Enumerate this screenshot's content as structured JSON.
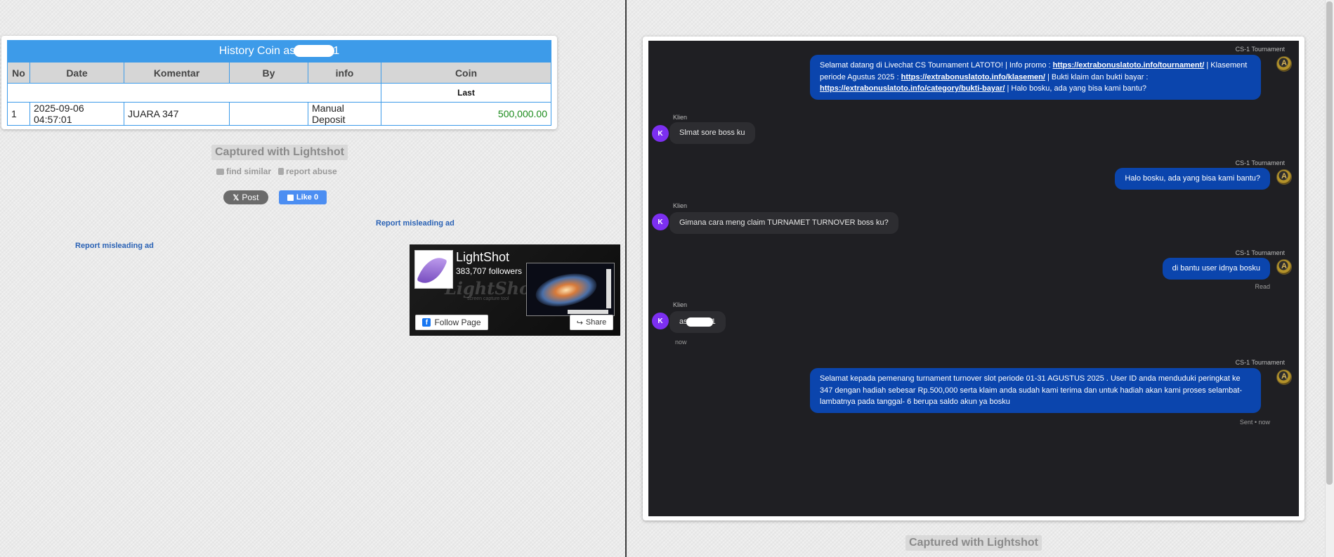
{
  "left": {
    "history": {
      "title_prefix": "History Coin as",
      "title_suffix": "1",
      "columns": [
        "No",
        "Date",
        "Komentar",
        "By",
        "info",
        "Coin"
      ],
      "last_label": "Last",
      "row": {
        "no": "1",
        "date": "2025-09-06 04:57:01",
        "komentar": "JUARA 347",
        "by": "",
        "info": "Manual Deposit",
        "coin": "500,000.00"
      }
    },
    "caption": "Captured with Lightshot",
    "find_similar": "find similar",
    "report_abuse": "report abuse",
    "post_label": "Post",
    "like_label": "Like 0",
    "report_ad_1": "Report misleading ad",
    "report_ad_2": "Report misleading ad",
    "fb_widget": {
      "page_name": "LightShot",
      "followers": "383,707 followers",
      "watermark": "LightShot",
      "watermark_sub": "screen capture tool",
      "follow_label": "Follow Page",
      "share_label": "Share"
    }
  },
  "right": {
    "caption": "Captured with Lightshot",
    "messages": {
      "m1": {
        "sender": "CS-1 Tournament",
        "t1": "Selamat datang di Livechat CS Tournament LATOTO! | Info promo : ",
        "link1": "https://extrabonuslatoto.info/tournament/",
        "t2": " | Klasement periode Agustus 2025 : ",
        "link2": "https://extrabonuslatoto.info/klasemen/",
        "t3": " | Bukti klaim dan bukti bayar : ",
        "link3": "https://extrabonuslatoto.info/category/bukti-bayar/",
        "t4": " | Halo bosku, ada yang bisa kami bantu?"
      },
      "m2": {
        "sender": "Klien",
        "avatar": "K",
        "text": "Slmat sore boss ku"
      },
      "m3": {
        "sender": "CS-1 Tournament",
        "text": "Halo bosku, ada yang bisa kami bantu?"
      },
      "m4": {
        "sender": "Klien",
        "avatar": "K",
        "text": "Gimana cara meng claim TURNAMET TURNOVER boss ku?"
      },
      "m5": {
        "sender": "CS-1 Tournament",
        "text": "di bantu user idnya bosku",
        "status": "Read"
      },
      "m6": {
        "sender": "Klien",
        "avatar": "K",
        "prefix": "as",
        "suffix": "1",
        "time": "now"
      },
      "m7": {
        "sender": "CS-1 Tournament",
        "text": "Selamat kepada pemenang turnament turnover slot periode 01-31 AGUSTUS 2025 . User ID anda menduduki peringkat ke 347 dengan hadiah sebesar Rp.500,000 serta klaim anda sudah kami terima dan untuk hadiah akan kami proses selambat-lambatnya pada tanggal- 6 berupa saldo akun ya bosku",
        "status": "Sent • now"
      }
    }
  }
}
